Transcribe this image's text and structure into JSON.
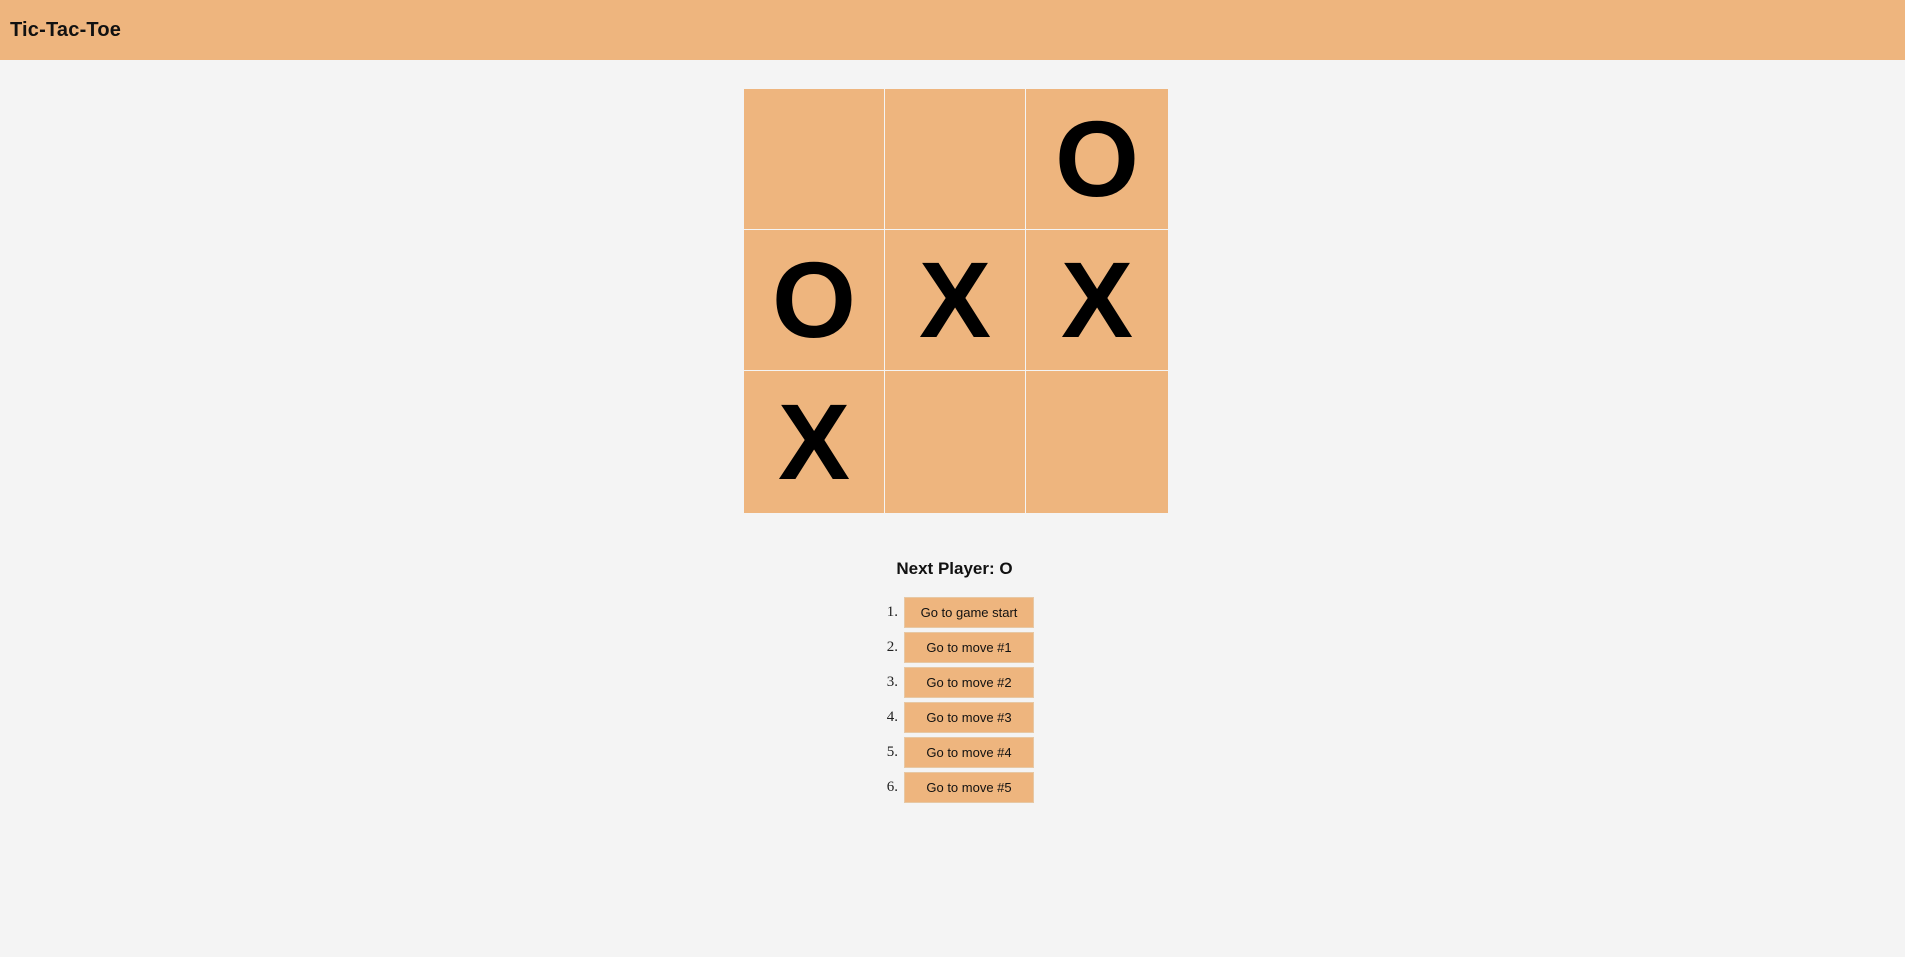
{
  "header": {
    "title": "Tic-Tac-Toe"
  },
  "board": {
    "cells": [
      "",
      "",
      "O",
      "O",
      "X",
      "X",
      "X",
      "",
      ""
    ]
  },
  "status": {
    "text": "Next Player: O"
  },
  "history": {
    "numbers": [
      "1.",
      "2.",
      "3.",
      "4.",
      "5.",
      "6."
    ],
    "items": [
      "Go to game start",
      "Go to move #1",
      "Go to move #2",
      "Go to move #3",
      "Go to move #4",
      "Go to move #5"
    ]
  },
  "colors": {
    "accent": "#eeb57e",
    "background": "#f4f4f4",
    "text": "#000000"
  }
}
